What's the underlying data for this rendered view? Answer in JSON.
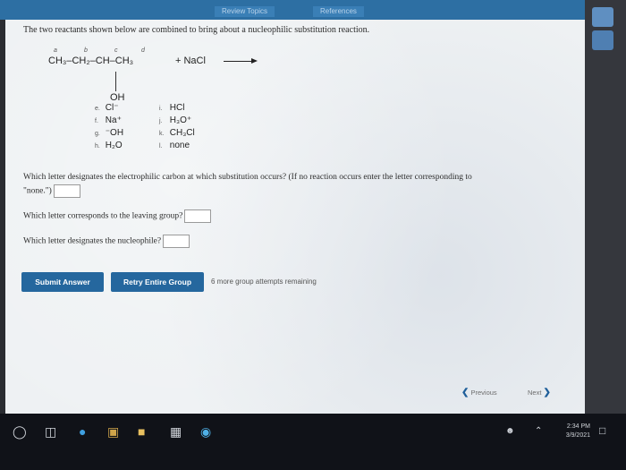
{
  "header": {
    "tab1": "Review Topics",
    "tab2": "References"
  },
  "question": {
    "intro": "The two reactants shown below are combined to bring about a nucleophilic substitution reaction.",
    "molecule": "CH₃–CH₂–CH–CH₃",
    "carbon_letters": [
      "a",
      "b",
      "c",
      "d"
    ],
    "substituent": "OH",
    "reagent": "+ NaCl",
    "choices_left": [
      {
        "letter": "e.",
        "text": "Cl⁻"
      },
      {
        "letter": "f.",
        "text": "Na⁺"
      },
      {
        "letter": "g.",
        "text": "⁻OH"
      },
      {
        "letter": "h.",
        "text": "H₂O"
      }
    ],
    "choices_right": [
      {
        "letter": "i.",
        "text": "HCl"
      },
      {
        "letter": "j.",
        "text": "H₃O⁺"
      },
      {
        "letter": "k.",
        "text": "CH₃Cl"
      },
      {
        "letter": "l.",
        "text": "none"
      }
    ],
    "q1": "Which letter designates the electrophilic carbon at which substitution occurs? (If no reaction occurs enter the letter corresponding to",
    "q1b": "\"none.\")",
    "q2": "Which letter corresponds to the leaving group?",
    "q3": "Which letter designates the nucleophile?"
  },
  "actions": {
    "submit": "Submit Answer",
    "retry": "Retry Entire Group",
    "remaining": "6 more group attempts remaining"
  },
  "nav": {
    "previous": "Previous",
    "next": "Next"
  },
  "taskbar": {
    "time": "2:34 PM",
    "date": "3/9/2021"
  }
}
